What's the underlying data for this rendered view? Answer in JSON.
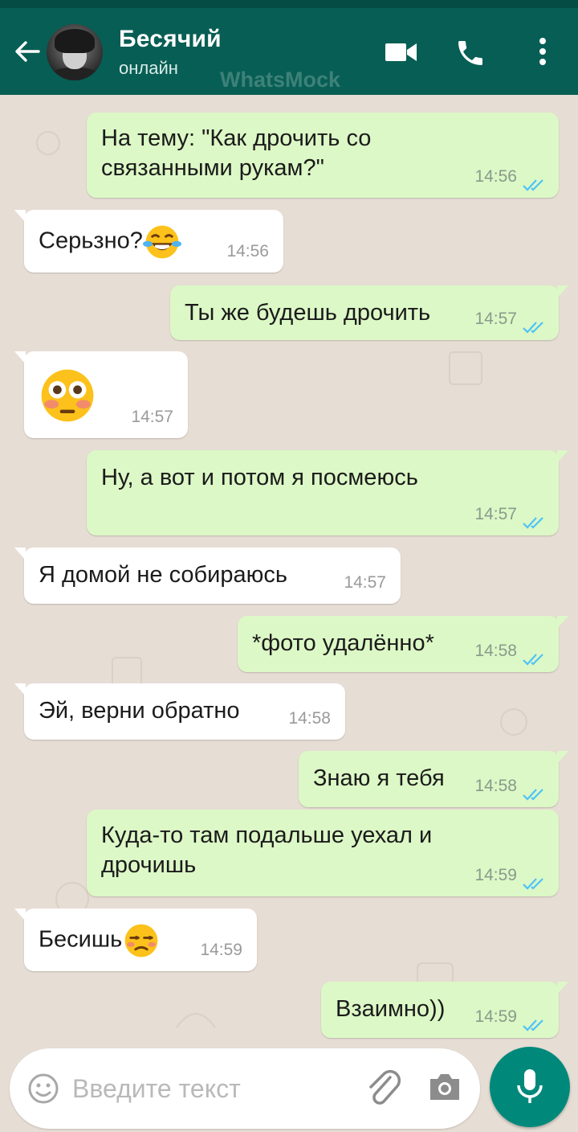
{
  "header": {
    "contact_name": "Бесячий",
    "status": "онлайн",
    "watermark": "WhatsMock"
  },
  "messages": [
    {
      "direction": "out",
      "lines": [
        "На тему: \"Как дрочить со",
        "связанными рукам?\""
      ],
      "time": "14:56",
      "status": "read"
    },
    {
      "direction": "in",
      "lines": [
        "Серьзно?"
      ],
      "emoji": "face-with-tears-of-joy",
      "time": "14:56"
    },
    {
      "direction": "out",
      "lines": [
        "Ты же будешь дрочить"
      ],
      "time": "14:57",
      "status": "read"
    },
    {
      "direction": "in",
      "lines": [
        ""
      ],
      "emoji": "flushed-face",
      "time": "14:57"
    },
    {
      "direction": "out",
      "lines": [
        "Ну, а вот и потом я посмеюсь"
      ],
      "time": "14:57",
      "status": "read"
    },
    {
      "direction": "in",
      "lines": [
        "Я домой не собираюсь"
      ],
      "time": "14:57"
    },
    {
      "direction": "out",
      "lines": [
        "*фото удалённо*"
      ],
      "time": "14:58",
      "status": "read"
    },
    {
      "direction": "in",
      "lines": [
        "Эй, верни обратно"
      ],
      "time": "14:58"
    },
    {
      "direction": "out",
      "lines": [
        "Знаю я тебя"
      ],
      "time": "14:58",
      "status": "read"
    },
    {
      "direction": "out",
      "lines": [
        "Куда-то там подальше уехал и",
        "дрочишь"
      ],
      "time": "14:59",
      "status": "read"
    },
    {
      "direction": "in",
      "lines": [
        "Бесишь"
      ],
      "emoji": "unamused-face",
      "time": "14:59"
    },
    {
      "direction": "out",
      "lines": [
        "Взаимно))"
      ],
      "time": "14:59",
      "status": "read"
    }
  ],
  "composer": {
    "placeholder": "Введите текст"
  },
  "colors": {
    "header": "#075e54",
    "outgoing_bubble": "#dcf8c6",
    "incoming_bubble": "#ffffff",
    "read_ticks": "#4fc3f7",
    "mic_button": "#00897b"
  },
  "icons": [
    "back-arrow-icon",
    "video-call-icon",
    "phone-icon",
    "more-vert-icon",
    "emoji-icon",
    "attach-icon",
    "camera-icon",
    "mic-icon"
  ]
}
